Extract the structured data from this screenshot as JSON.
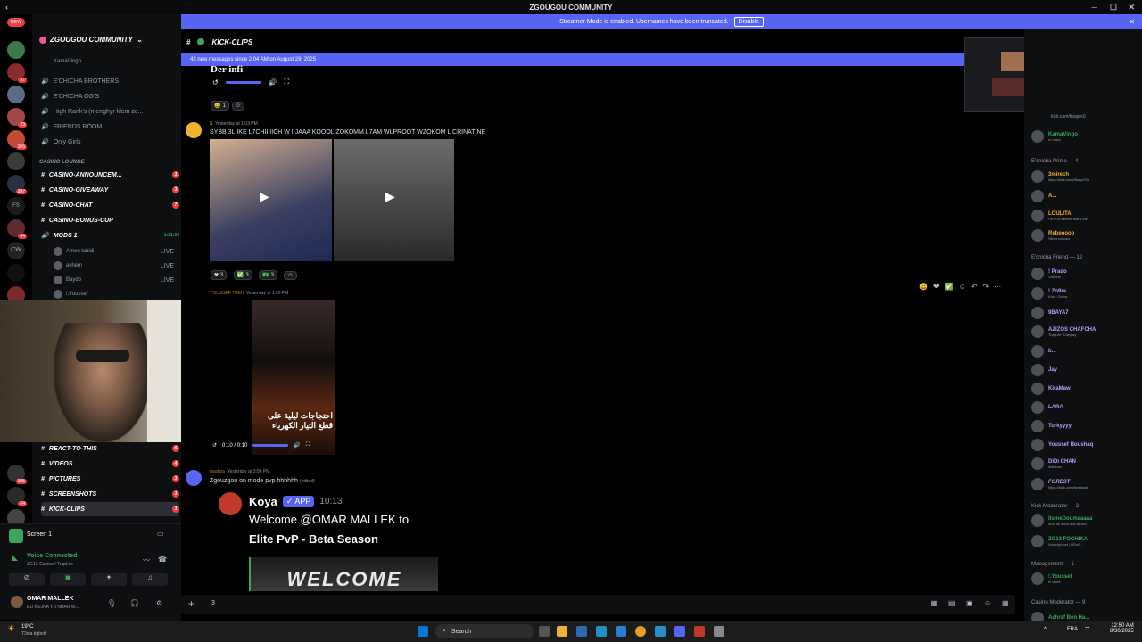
{
  "window": {
    "title": "ZGOUGOU COMMUNITY"
  },
  "banner": {
    "text": "Streamer Mode is enabled. Usernames have been truncated.",
    "disable_label": "Disable"
  },
  "sidebar": {
    "guild_name": "ZGOUGOU COMMUNITY",
    "voice_user_top": "KamaVingo",
    "channels_top": [
      "E'CHICHA BROTHERS",
      "E'CHICHA OG'S",
      "High Rank's (menghyr klem ze...",
      "FRIENDS ROOM",
      "Only Girls"
    ],
    "category_casino": "CASINO LOUNGE",
    "casino_channels": [
      {
        "name": "CASINO-ANNOUNCEM...",
        "count": "1"
      },
      {
        "name": "CASINO-GIVEAWAY",
        "count": "3"
      },
      {
        "name": "CASINO-CHAT",
        "count": "7"
      },
      {
        "name": "CASINO-BONUS-CUP",
        "count": ""
      }
    ],
    "mods_channel": "MODS 1",
    "mods_timer": "1:31:04",
    "mods_users": [
      "Amen labidi",
      "ayhem",
      "Baydo",
      "!.Youssef"
    ],
    "live_label": "LIVE",
    "bottom_channels": [
      {
        "name": "REACT-TO-THIS",
        "count": "6"
      },
      {
        "name": "VIDEOS",
        "count": "4"
      },
      {
        "name": "PICTURES",
        "count": "3"
      },
      {
        "name": "SCREENSHOTS",
        "count": "1"
      },
      {
        "name": "KICK-CLIPS",
        "count": "1"
      }
    ]
  },
  "voice_panel": {
    "screen_label": "Screen 1",
    "status": "Voice Connected",
    "location": "ZG13-Casino / TrapLife",
    "user_name": "OMAR MALLEK",
    "user_status": "ELI BEJNA Y.II NHAR W..."
  },
  "chat": {
    "channel_name": "KICK-CLIPS",
    "new_messages": "42 new messages since 2:04 AM on August 29, 2025",
    "partial_text": "Der infi",
    "reaction_top": "1",
    "msg1": {
      "author": "S",
      "time": "Yesterday at 1:03 PM",
      "text": "SYBB 3LIIKE L7CHIIIIICH W IIJAAA KOOOL ZOKOMM L7AM WLPROOT WZOKOM L CRINATINE",
      "reactions": [
        "3",
        "3",
        "3"
      ]
    },
    "msg2": {
      "author": "YOUSSEF TRIKI",
      "time": "Yesterday at 1:30 PM",
      "video_time": "0:10 / 0:10",
      "video_caption": "احتجاجات ليلية على قطع التيار الكهرباء"
    },
    "msg3": {
      "author": "madara",
      "time": "Yesterday at 3:06 PM",
      "text": "Zgouzgou on mode pvp hhhhhh",
      "edited": "(edited)"
    },
    "embed": {
      "bot_name": "Koya",
      "app_tag": "APP",
      "bot_time": "10:13",
      "welcome_line": "Welcome @OMAR MALLEK to",
      "season": "Elite PvP - Beta Season",
      "banner_text": "WELCOME"
    },
    "input_value": "3"
  },
  "members": {
    "groups": [
      {
        "title": "E'chicha Prime — 4",
        "users": [
          {
            "name": "3mirech",
            "status": "https://kick.com/9baya701",
            "color": "#f0b232"
          },
          {
            "name": "A...",
            "status": "",
            "color": "#dbdee1"
          },
          {
            "name": "LOULITA",
            "status": "I'm in a lifetime that's me",
            "color": "#f0b232"
          },
          {
            "name": "Rebeoooo",
            "status": "Silent echoes",
            "color": "#f0b232"
          }
        ]
      },
      {
        "title": "E'chicha Friend — 12",
        "users": [
          {
            "name": "! Prado",
            "status": "Sherine",
            "color": "#b6a0ff"
          },
          {
            "name": "! Zo9ra",
            "status": "Kick : Zo9ra",
            "color": "#b6a0ff"
          },
          {
            "name": "9BAYA7",
            "status": "",
            "color": "#b6a0ff"
          },
          {
            "name": "AZIZOS CHAFCHA",
            "status": "TrapLife Roleplay",
            "color": "#b6a0ff"
          },
          {
            "name": "b...",
            "status": "",
            "color": "#b6a0ff"
          },
          {
            "name": "Jay",
            "status": "",
            "color": "#b6a0ff"
          },
          {
            "name": "KiraMaw",
            "status": "",
            "color": "#b6a0ff"
          },
          {
            "name": "LARA",
            "status": "",
            "color": "#b6a0ff"
          },
          {
            "name": "Turkyyyy",
            "status": "",
            "color": "#b6a0ff"
          },
          {
            "name": "Youssef Boushaq",
            "status": "",
            "color": "#b6a0ff"
          },
          {
            "name": "DiDi CHAN",
            "status": "didichan",
            "color": "#b6a0ff"
          },
          {
            "name": "FOREST",
            "status": "https://kick.com/forestval",
            "color": "#b6a0ff"
          }
        ]
      },
      {
        "title": "Kick Moderator — 2",
        "users": [
          {
            "name": "itsmeDoumaaaaa",
            "status": "mon ml sono mal arreso",
            "color": "#3ba55c"
          },
          {
            "name": "ZG13 FOCHIKA",
            "status": "VelocityHost | DDoS ...",
            "color": "#3ba55c"
          }
        ]
      },
      {
        "title": "Management — 1",
        "users": [
          {
            "name": "!.Youssef",
            "status": "In voice",
            "color": "#3ba55c"
          }
        ]
      },
      {
        "title": "Casino Moderator — 9",
        "users": [
          {
            "name": "Achraf Ben Ha...",
            "status": "",
            "color": "#3ba55c"
          }
        ]
      }
    ],
    "top_users": [
      {
        "name": "KamaVingo",
        "status": "In voice",
        "color": "#3ba55c"
      }
    ],
    "top_status": "kick.com/itsapro0"
  },
  "taskbar": {
    "weather_temp": "19°C",
    "weather_desc": "T3sla égboit",
    "search": "Search",
    "lang": "FRA",
    "time": "12:50 AM",
    "date": "8/30/2025"
  }
}
